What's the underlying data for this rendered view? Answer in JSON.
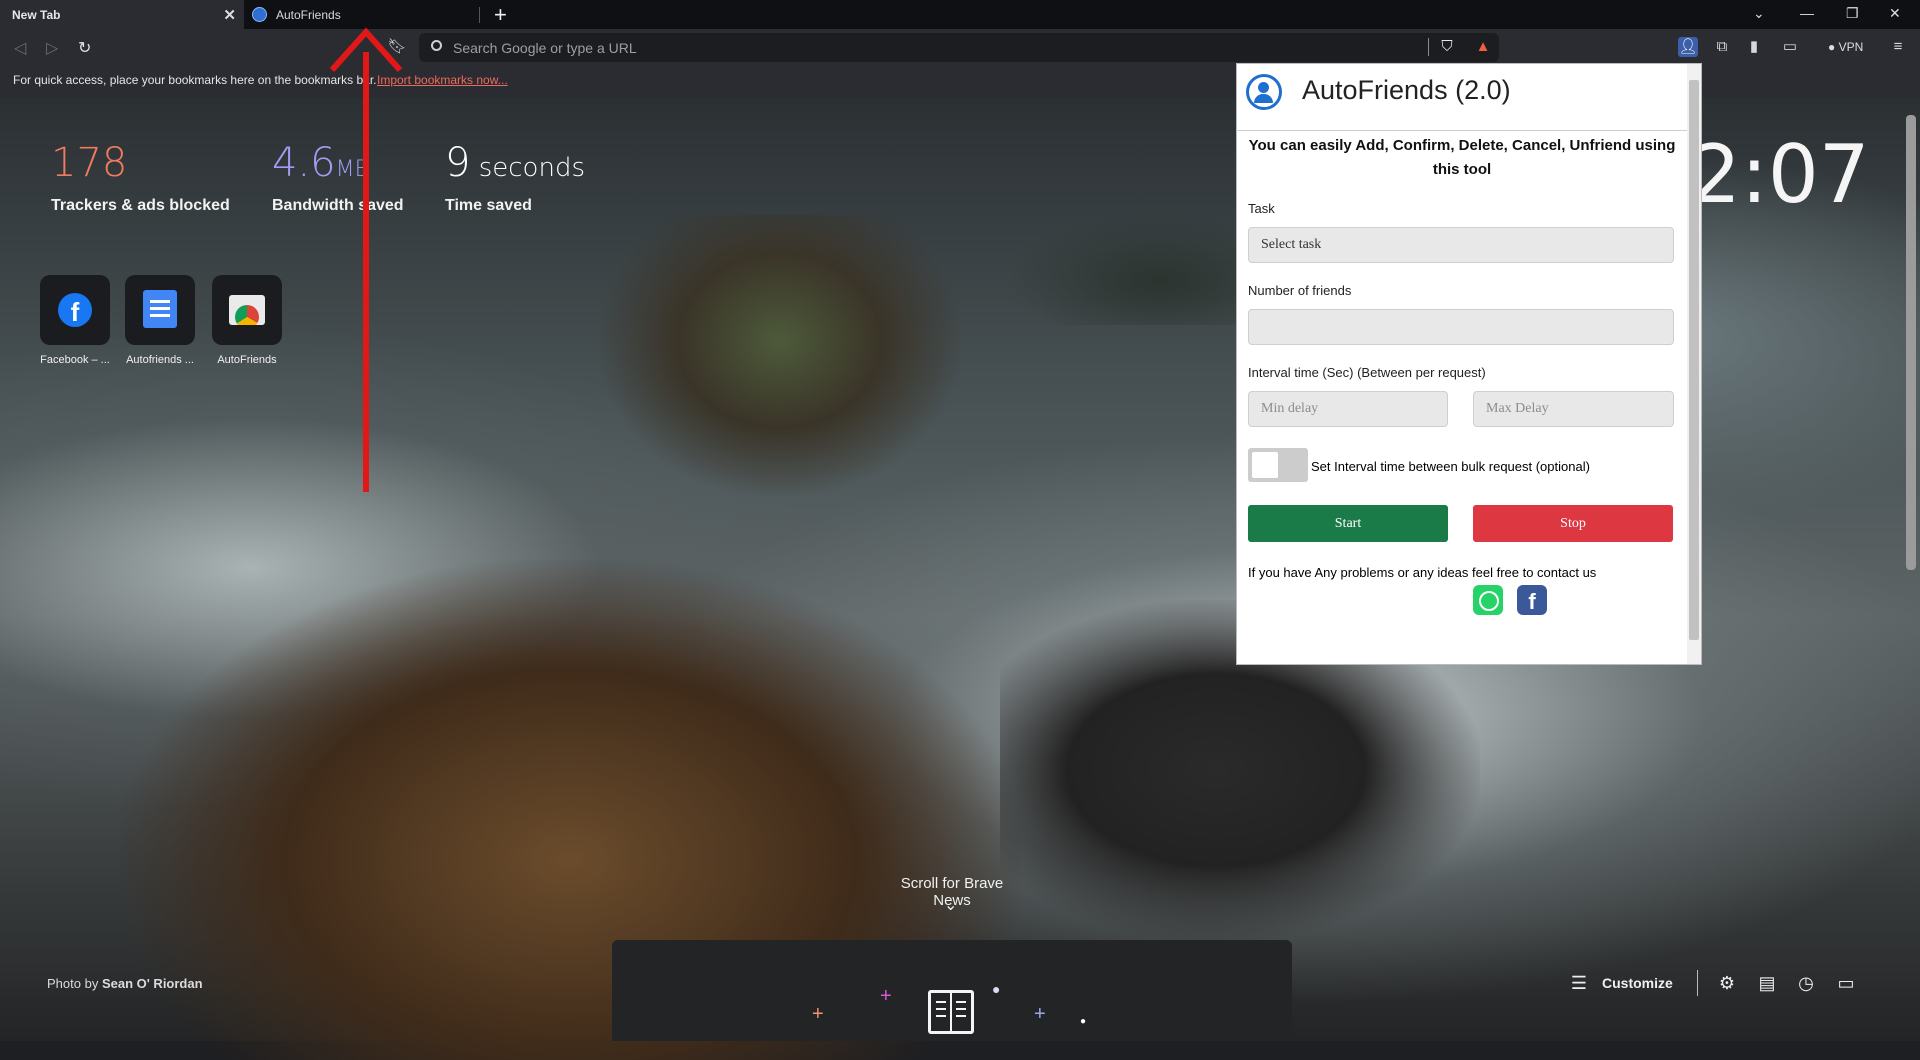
{
  "tabs": [
    {
      "label": "New Tab",
      "active": true
    },
    {
      "label": "AutoFriends",
      "active": false
    }
  ],
  "omnibox": {
    "placeholder": "Search Google or type a URL"
  },
  "toolbar": {
    "vpn_label": "VPN"
  },
  "bookmarks_bar": {
    "message": "For quick access, place your bookmarks here on the bookmarks bar.",
    "import_link": "Import bookmarks now..."
  },
  "stats": [
    {
      "value": "178",
      "unit": "",
      "label": "Trackers & ads blocked",
      "color": "#f07b5f"
    },
    {
      "value": "4.6",
      "unit": "MB",
      "label": "Bandwidth saved",
      "color": "#a19df2"
    },
    {
      "value": "9",
      "unit": "seconds",
      "label": "Time saved",
      "color": "#ffffff"
    }
  ],
  "clock": "2:07",
  "top_sites": [
    {
      "label": "Facebook – ...",
      "icon": "facebook-icon"
    },
    {
      "label": "Autofriends ...",
      "icon": "document-icon"
    },
    {
      "label": "AutoFriends",
      "icon": "web-store-icon"
    }
  ],
  "popup": {
    "title": "AutoFriends (2.0)",
    "description": "You can easily Add, Confirm, Delete, Cancel, Unfriend using this tool",
    "task_label": "Task",
    "task_value": "Select task",
    "friends_label": "Number of friends",
    "friends_value": "",
    "interval_label": "Interval time (Sec) (Between per request)",
    "min_delay_placeholder": "Min delay",
    "max_delay_placeholder": "Max Delay",
    "bulk_toggle_label": "Set Interval time between bulk request (optional)",
    "bulk_toggle_on": false,
    "start_label": "Start",
    "stop_label": "Stop",
    "contact_text": "If you have Any problems or any ideas feel free to contact us",
    "accent": "#1f6fd0",
    "start_color": "#1a7a48",
    "stop_color": "#dd3741"
  },
  "footer": {
    "scroll_news": "Scroll for Brave News",
    "photo_credit_prefix": "Photo by ",
    "photo_credit_name": "Sean O' Riordan",
    "customize_label": "Customize"
  }
}
